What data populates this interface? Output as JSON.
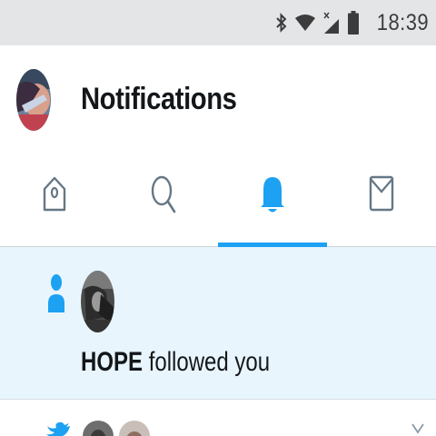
{
  "status_bar": {
    "time": "18:39",
    "icons": [
      "bluetooth-icon",
      "wifi-icon",
      "signal-icon",
      "battery-icon"
    ]
  },
  "header": {
    "title": "Notifications",
    "avatar": "profile-avatar"
  },
  "tabs": [
    {
      "name": "home",
      "icon": "home-icon",
      "active": false
    },
    {
      "name": "search",
      "icon": "search-icon",
      "active": false
    },
    {
      "name": "notifications",
      "icon": "bell-icon",
      "active": true
    },
    {
      "name": "messages",
      "icon": "mail-icon",
      "active": false
    }
  ],
  "notifications": [
    {
      "type": "follow",
      "icon": "person-icon",
      "user": "HOPE",
      "action": "followed you"
    },
    {
      "type": "retweet",
      "icon": "bird-icon",
      "menu_icon": "chevron-down-icon"
    }
  ],
  "colors": {
    "accent": "#1da1f2",
    "highlight_bg": "#e8f5fd",
    "status_bar_bg": "#e4e5e6",
    "tab_icon": "#657786"
  }
}
